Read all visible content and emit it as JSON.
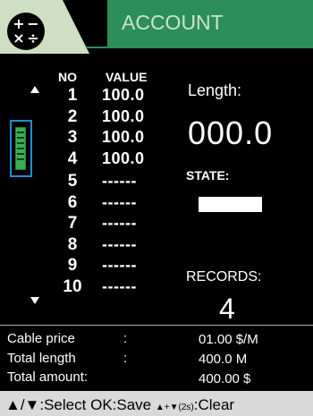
{
  "header": {
    "title": "ACCOUNT",
    "calc_icon": "calculator-icon",
    "calc_symbols": [
      "+",
      "−",
      "×",
      "÷"
    ],
    "colors": {
      "title_bar": "#2c8e58",
      "badge": "#cfe0c2",
      "title_text": "#c9e6c9"
    }
  },
  "table": {
    "no_header": "NO",
    "value_header": "VALUE",
    "rows": [
      {
        "no": "1",
        "value": "100.0"
      },
      {
        "no": "2",
        "value": "100.0"
      },
      {
        "no": "3",
        "value": "100.0"
      },
      {
        "no": "4",
        "value": "100.0"
      },
      {
        "no": "5",
        "value": "------"
      },
      {
        "no": "6",
        "value": "------"
      },
      {
        "no": "7",
        "value": "------"
      },
      {
        "no": "8",
        "value": "------"
      },
      {
        "no": "9",
        "value": "------"
      },
      {
        "no": "10",
        "value": "------"
      }
    ]
  },
  "battery": {
    "icon": "battery-icon",
    "color": "#39b050",
    "border": "#1e8fd0"
  },
  "panel": {
    "length_label": "Length:",
    "length_value": "000.0",
    "state_label": "STATE:",
    "records_label": "RECORDS:",
    "records_value": "4"
  },
  "summary": {
    "cable_price_label": "Cable price",
    "cable_price_value": "01.00  $/M",
    "total_length_label": "Total length",
    "total_length_value": "400.0  M",
    "total_amount_label": "Total amount:",
    "total_amount_value": "400.00 $",
    "colon": ":"
  },
  "footer": {
    "select": "▲/▼:Select",
    "save": "OK:Save",
    "clear_keys": "▲+▼(2s)",
    "clear": ":Clear"
  }
}
